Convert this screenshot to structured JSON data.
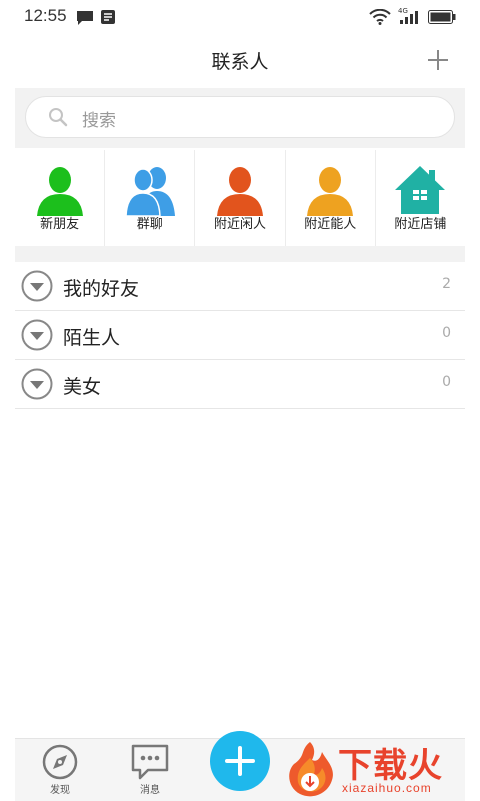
{
  "status_bar": {
    "time": "12:55",
    "network": "4G"
  },
  "header": {
    "title": "联系人"
  },
  "search": {
    "placeholder": "搜索"
  },
  "quick_actions": [
    {
      "label": "新朋友",
      "icon": "person-icon",
      "color": "#1cbf1c"
    },
    {
      "label": "群聊",
      "icon": "group-icon",
      "color": "#3e9ee6"
    },
    {
      "label": "附近闲人",
      "icon": "person-icon",
      "color": "#e2541d"
    },
    {
      "label": "附近能人",
      "icon": "person-icon",
      "color": "#eea220"
    },
    {
      "label": "附近店铺",
      "icon": "shop-icon",
      "color": "#20b1a4"
    }
  ],
  "groups": [
    {
      "name": "我的好友",
      "count": "2"
    },
    {
      "name": "陌生人",
      "count": "0"
    },
    {
      "name": "美女",
      "count": "0"
    }
  ],
  "bottom_nav": {
    "discover_label": "发现",
    "messages_label": "消息"
  },
  "watermark": {
    "brand": "下载火",
    "domain": "xiazaihuo.com"
  },
  "colors": {
    "accent": "#1fb8ec",
    "watermark": "#e8432c"
  }
}
